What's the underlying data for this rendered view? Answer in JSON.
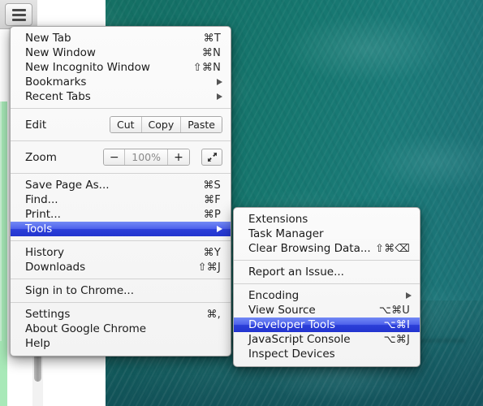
{
  "toolbar": {
    "menu_button_name": "chrome-menu-button",
    "menu_button_icon": "hamburger-icon"
  },
  "main_menu": {
    "groups": [
      {
        "items": [
          {
            "label": "New Tab",
            "shortcut": "⌘T",
            "arrow": false,
            "type": "item"
          },
          {
            "label": "New Window",
            "shortcut": "⌘N",
            "arrow": false,
            "type": "item"
          },
          {
            "label": "New Incognito Window",
            "shortcut": "⇧⌘N",
            "arrow": false,
            "type": "item"
          },
          {
            "label": "Bookmarks",
            "shortcut": "",
            "arrow": true,
            "type": "item"
          },
          {
            "label": "Recent Tabs",
            "shortcut": "",
            "arrow": true,
            "type": "item"
          }
        ]
      },
      {
        "items": [
          {
            "label": "Edit",
            "type": "edit",
            "buttons": [
              {
                "label": "Cut",
                "name": "cut-button"
              },
              {
                "label": "Copy",
                "name": "copy-button"
              },
              {
                "label": "Paste",
                "name": "paste-button"
              }
            ]
          }
        ]
      },
      {
        "items": [
          {
            "label": "Zoom",
            "type": "zoom",
            "minus": "−",
            "value": "100%",
            "plus": "+",
            "fullscreen_icon": "fullscreen-arrows-icon"
          }
        ]
      },
      {
        "items": [
          {
            "label": "Save Page As...",
            "shortcut": "⌘S",
            "arrow": false,
            "type": "item"
          },
          {
            "label": "Find...",
            "shortcut": "⌘F",
            "arrow": false,
            "type": "item"
          },
          {
            "label": "Print...",
            "shortcut": "⌘P",
            "arrow": false,
            "type": "item"
          },
          {
            "label": "Tools",
            "shortcut": "",
            "arrow": true,
            "type": "item",
            "highlighted": true
          }
        ]
      },
      {
        "items": [
          {
            "label": "History",
            "shortcut": "⌘Y",
            "arrow": false,
            "type": "item"
          },
          {
            "label": "Downloads",
            "shortcut": "⇧⌘J",
            "arrow": false,
            "type": "item"
          }
        ]
      },
      {
        "items": [
          {
            "label": "Sign in to Chrome...",
            "shortcut": "",
            "arrow": false,
            "type": "item"
          }
        ]
      },
      {
        "items": [
          {
            "label": "Settings",
            "shortcut": "⌘,",
            "arrow": false,
            "type": "item"
          },
          {
            "label": "About Google Chrome",
            "shortcut": "",
            "arrow": false,
            "type": "item"
          },
          {
            "label": "Help",
            "shortcut": "",
            "arrow": false,
            "type": "item"
          }
        ]
      }
    ]
  },
  "sub_menu": {
    "groups": [
      {
        "items": [
          {
            "label": "Extensions",
            "shortcut": "",
            "arrow": false
          },
          {
            "label": "Task Manager",
            "shortcut": "",
            "arrow": false
          },
          {
            "label": "Clear Browsing Data...",
            "shortcut": "⇧⌘⌫",
            "arrow": false
          }
        ]
      },
      {
        "items": [
          {
            "label": "Report an Issue...",
            "shortcut": "",
            "arrow": false
          }
        ]
      },
      {
        "items": [
          {
            "label": "Encoding",
            "shortcut": "",
            "arrow": true
          },
          {
            "label": "View Source",
            "shortcut": "⌥⌘U",
            "arrow": false
          },
          {
            "label": "Developer Tools",
            "shortcut": "⌥⌘I",
            "arrow": false,
            "highlighted": true
          },
          {
            "label": "JavaScript Console",
            "shortcut": "⌥⌘J",
            "arrow": false
          },
          {
            "label": "Inspect Devices",
            "shortcut": "",
            "arrow": false
          }
        ]
      }
    ]
  },
  "colors": {
    "highlight_blue": "#2c3fd8",
    "menu_background": "#f7f7f7",
    "desktop_teal": "#15695f",
    "accent_green": "#a8e9b8"
  }
}
